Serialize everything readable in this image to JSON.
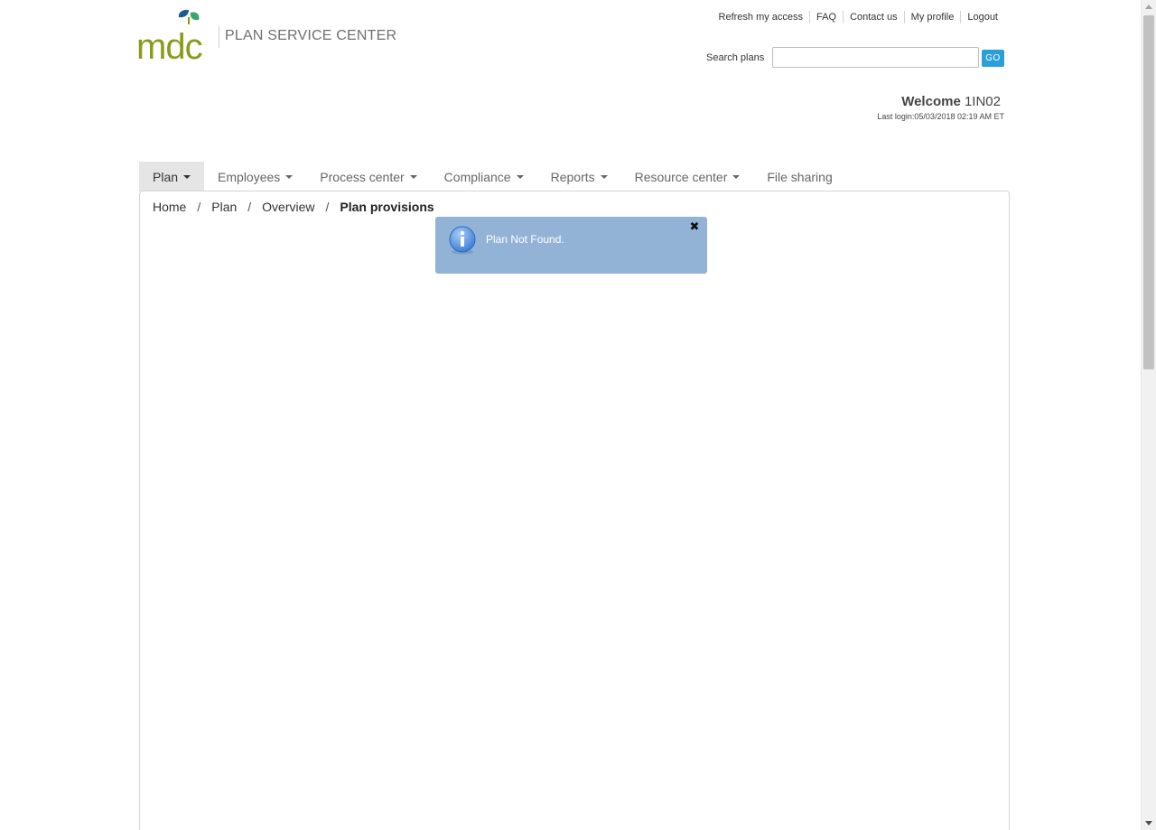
{
  "brand": {
    "logo_text": "mdc",
    "title": "PLAN SERVICE CENTER",
    "logo_color": "#8a9a1b",
    "leaf_colors": [
      "#1a5e8a",
      "#3aa66b"
    ]
  },
  "top_links": [
    {
      "label": "Refresh my access"
    },
    {
      "label": "FAQ"
    },
    {
      "label": "Contact us"
    },
    {
      "label": "My profile"
    },
    {
      "label": "Logout"
    }
  ],
  "search": {
    "label": "Search plans",
    "value": "",
    "placeholder": "",
    "go_label": "GO"
  },
  "user": {
    "welcome_label": "Welcome",
    "user_id": "1IN02",
    "last_login": "Last login:05/03/2018 02:19 AM ET"
  },
  "nav": [
    {
      "label": "Plan",
      "dropdown": true,
      "active": true
    },
    {
      "label": "Employees",
      "dropdown": true
    },
    {
      "label": "Process center",
      "dropdown": true
    },
    {
      "label": "Compliance",
      "dropdown": true
    },
    {
      "label": "Reports",
      "dropdown": true
    },
    {
      "label": "Resource center",
      "dropdown": true
    },
    {
      "label": "File sharing",
      "dropdown": false
    }
  ],
  "breadcrumb": {
    "items": [
      "Home",
      "Plan",
      "Overview"
    ],
    "current": "Plan provisions",
    "separator": "/"
  },
  "notification": {
    "type": "info",
    "icon": "info-icon",
    "message": "Plan Not Found.",
    "close_icon": "close-icon",
    "background": "#93b3d6"
  },
  "colors": {
    "accent": "#2a9fd8",
    "nav_active_bg": "#e5e5e5"
  }
}
